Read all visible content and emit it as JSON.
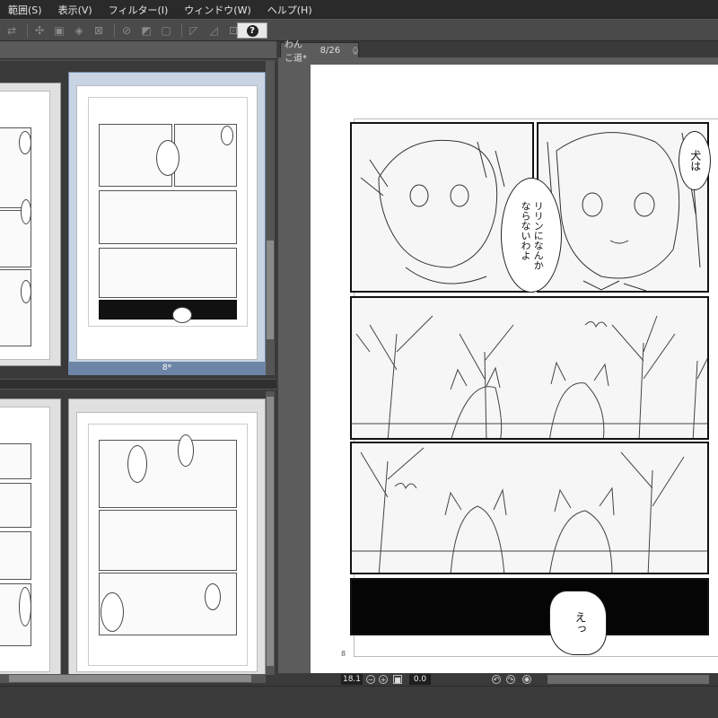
{
  "menubar": {
    "items": [
      {
        "label": "範囲(S)"
      },
      {
        "label": "表示(V)"
      },
      {
        "label": "フィルター(I)"
      },
      {
        "label": "ウィンドウ(W)"
      },
      {
        "label": "ヘルプ(H)"
      }
    ]
  },
  "toolbar": {
    "help_label": "?"
  },
  "pages_panel": {
    "selected_page_label": "8*"
  },
  "canvas": {
    "tab_title": "わんこ道*",
    "tab_page": "8/26",
    "page_number": "8",
    "bubbles": {
      "top_right": "犬は",
      "top_center": "リリンになんか\nならないわよ",
      "bottom": "えっ"
    }
  },
  "status": {
    "zoom": "18.1",
    "angle": "0.0"
  },
  "colors": {
    "selected_thumb": "#6d86a8",
    "menubar_bg": "#2a2a2a",
    "canvas_bg": "#5c5c5c"
  }
}
